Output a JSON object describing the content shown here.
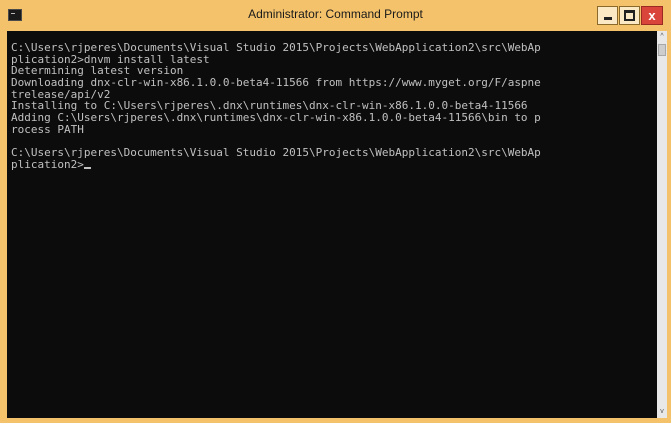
{
  "window": {
    "title": "Administrator: Command Prompt",
    "accent_color": "#f4c26a",
    "close_color": "#d9453a"
  },
  "controls": {
    "minimize_icon": "minimize-icon",
    "maximize_icon": "maximize-icon",
    "close_icon": "close-icon",
    "close_glyph": "x"
  },
  "console": {
    "background": "#0c0c0c",
    "foreground": "#c0c0c0",
    "lines": [
      "C:\\Users\\rjperes\\Documents\\Visual Studio 2015\\Projects\\WebApplication2\\src\\WebAp",
      "plication2>dnvm install latest",
      "Determining latest version",
      "Downloading dnx-clr-win-x86.1.0.0-beta4-11566 from https://www.myget.org/F/aspne",
      "trelease/api/v2",
      "Installing to C:\\Users\\rjperes\\.dnx\\runtimes\\dnx-clr-win-x86.1.0.0-beta4-11566",
      "Adding C:\\Users\\rjperes\\.dnx\\runtimes\\dnx-clr-win-x86.1.0.0-beta4-11566\\bin to p",
      "rocess PATH",
      "",
      "C:\\Users\\rjperes\\Documents\\Visual Studio 2015\\Projects\\WebApplication2\\src\\WebAp",
      "plication2>"
    ]
  },
  "scrollbar": {
    "up_glyph": "^",
    "down_glyph": "v"
  }
}
